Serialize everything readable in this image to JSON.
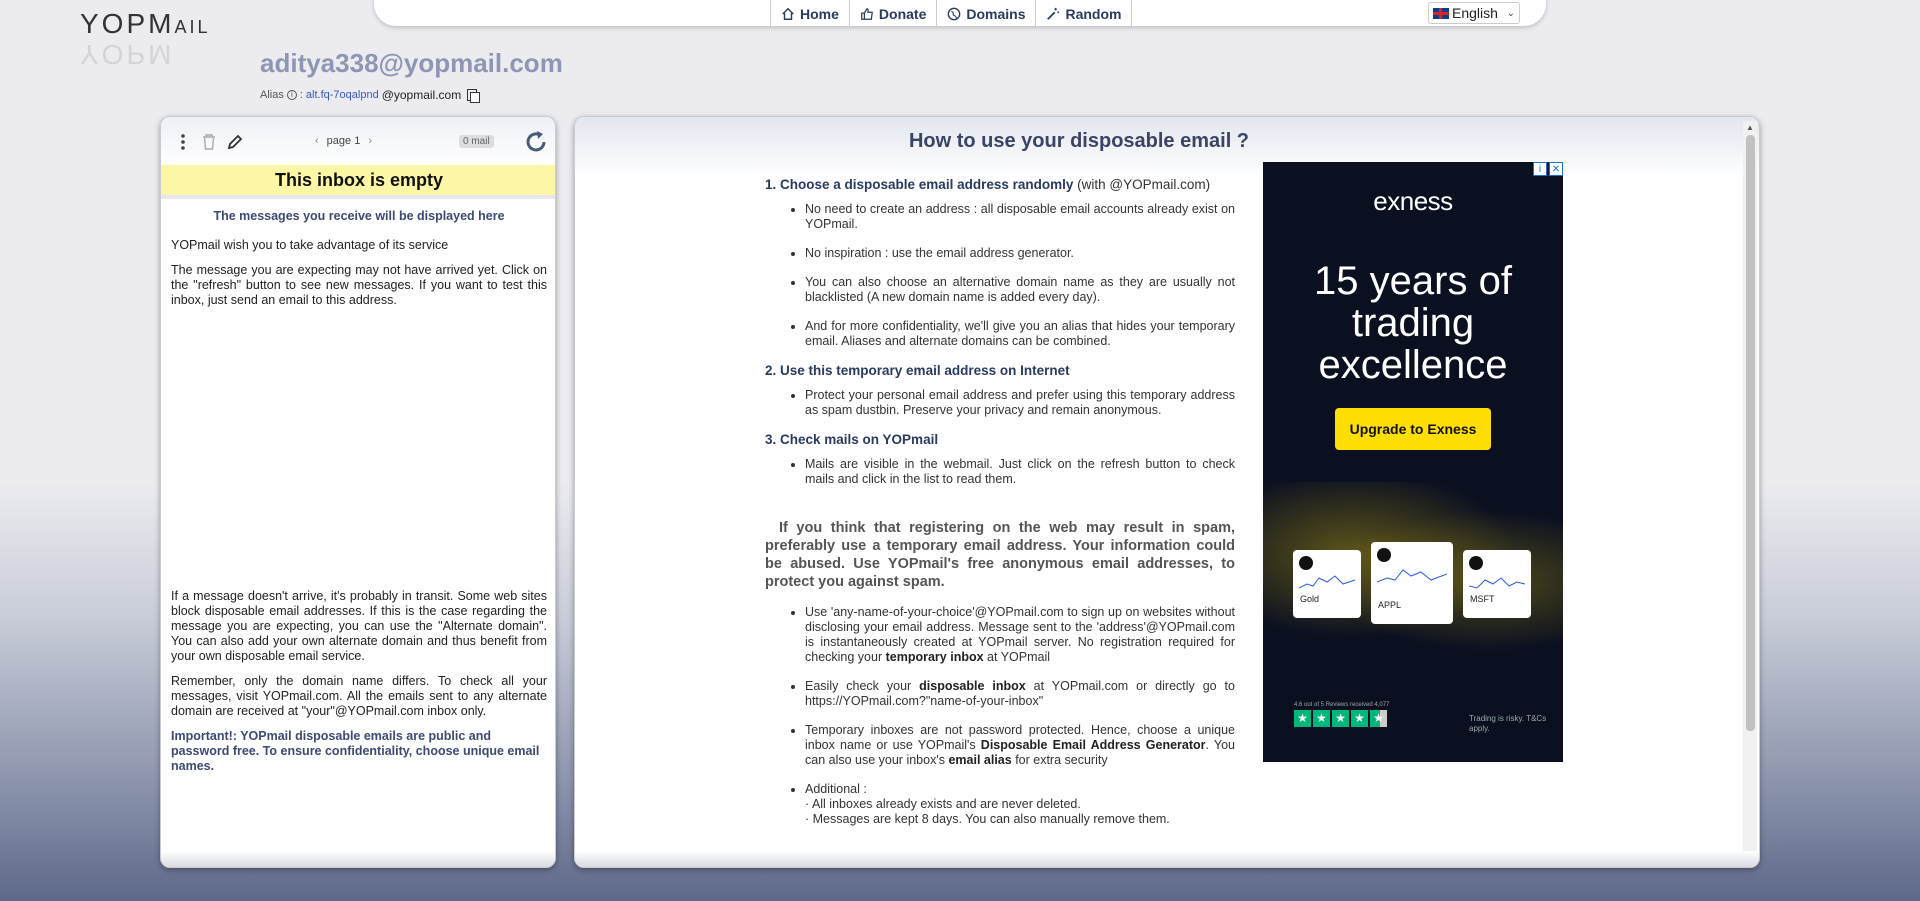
{
  "logo": {
    "text_big": "YOPM",
    "text_small": "AIL"
  },
  "nav": {
    "home": "Home",
    "donate": "Donate",
    "domains": "Domains",
    "random": "Random"
  },
  "language": {
    "selected": "English"
  },
  "inbox": {
    "email": "aditya338@yopmail.com",
    "alias_label": "Alias",
    "alias_value": "alt.fq-7oqalpnd",
    "alias_domain": "@yopmail.com"
  },
  "left_panel": {
    "page_label": "page 1",
    "mail_count": "0 mail",
    "empty_banner": "This inbox is empty",
    "lead": "The messages you receive will be displayed here",
    "p1": "YOPmail wish you to take advantage of its service",
    "p2": "The message you are expecting may not have arrived yet. Click on the \"refresh\" button to see new messages. If you want to test this inbox, just send an email to this address.",
    "p3": "If a message doesn't arrive, it's probably in transit. Some web sites block disposable email addresses. If this is the case regarding the message you are expecting, you can use the \"Alternate domain\". You can also add your own alternate domain and thus benefit from your own disposable email service.",
    "p4": "Remember, only the domain name differs. To check all your messages, visit YOPmail.com. All the emails sent to any alternate domain are received at \"your\"@YOPmail.com inbox only.",
    "important": "Important!: YOPmail disposable emails are public and password free. To ensure confidentiality, choose unique email names."
  },
  "right_panel": {
    "title": "How to use your disposable email ?",
    "s1_title": "1. Choose a disposable email address randomly",
    "s1_title_suffix": "(with @YOPmail.com)",
    "s1_items": [
      "No need to create an address : all disposable email accounts already exist on YOPmail.",
      "No inspiration : use the email address generator.",
      "You can also choose an alternative domain name as they are usually not blacklisted (A new domain name is added every day).",
      "And for more confidentiality, we'll give you an alias that hides your temporary email. Aliases and alternate domains can be combined."
    ],
    "s2_title": "2. Use this temporary email address on Internet",
    "s2_items": [
      "Protect your personal email address and prefer using this temporary address as spam dustbin. Preserve your privacy and remain anonymous."
    ],
    "s3_title": "3. Check mails on YOPmail",
    "s3_items": [
      "Mails are visible in the webmail. Just click on the refresh button to check mails and click in the list to read them."
    ],
    "warning": "If you think that registering on the web may result in spam, preferably use a temporary email address. Your information could be abused. Use YOPmail's free anonymous email addresses, to protect you against spam.",
    "b1_a": "Use 'any-name-of-your-choice'@YOPmail.com to sign up on websites without disclosing your email address. Message sent to the 'address'@YOPmail.com is instantaneously created at YOPmail server. No registration required for checking your",
    "b1_b": "temporary inbox",
    "b1_c": "at YOPmail",
    "b2_a": "Easily check your",
    "b2_b": "disposable inbox",
    "b2_c": "at YOPmail.com or directly go to https://YOPmail.com?\"name-of-your-inbox\"",
    "b3_a": "Temporary inboxes are not password protected. Hence, choose a unique inbox name or use YOPmail's",
    "b3_b": "Disposable Email Address Generator",
    "b3_c": ". You can also use your inbox's",
    "b3_d": "email alias",
    "b3_e": "for extra security",
    "b4_title": "Additional :",
    "b4_l1": "· All inboxes already exists and are never deleted.",
    "b4_l2": "· Messages are kept 8 days. You can also manually remove them."
  },
  "ad": {
    "brand": "exness",
    "headline": "15 years of trading excellence",
    "cta": "Upgrade to Exness",
    "cards": [
      "Gold",
      "APPL",
      "MSFT"
    ],
    "rating_text": "4.6 out of 5 Reviews received 4,077",
    "risk": "Trading is risky. T&Cs apply.",
    "accent": "#ffde02"
  }
}
